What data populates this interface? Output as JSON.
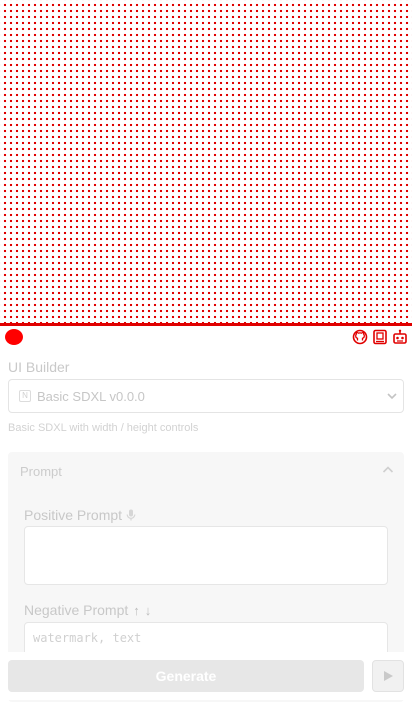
{
  "canvas": {
    "dot_color": "#e00000",
    "divider_color": "#e00000"
  },
  "status": {
    "icon": "status-dot",
    "color": "#ff0000"
  },
  "toolbar": {
    "icons": [
      "github-icon",
      "book-icon",
      "robot-icon"
    ]
  },
  "builder": {
    "label": "UI Builder",
    "selected": "Basic SDXL v0.0.0",
    "description": "Basic SDXL with width / height controls"
  },
  "prompt_section": {
    "title": "Prompt",
    "positive_label": "Positive Prompt",
    "positive_value": "",
    "negative_label": "Negative Prompt",
    "negative_value": "watermark, text"
  },
  "actions": {
    "generate_label": "Generate",
    "run_icon": "play-icon"
  }
}
